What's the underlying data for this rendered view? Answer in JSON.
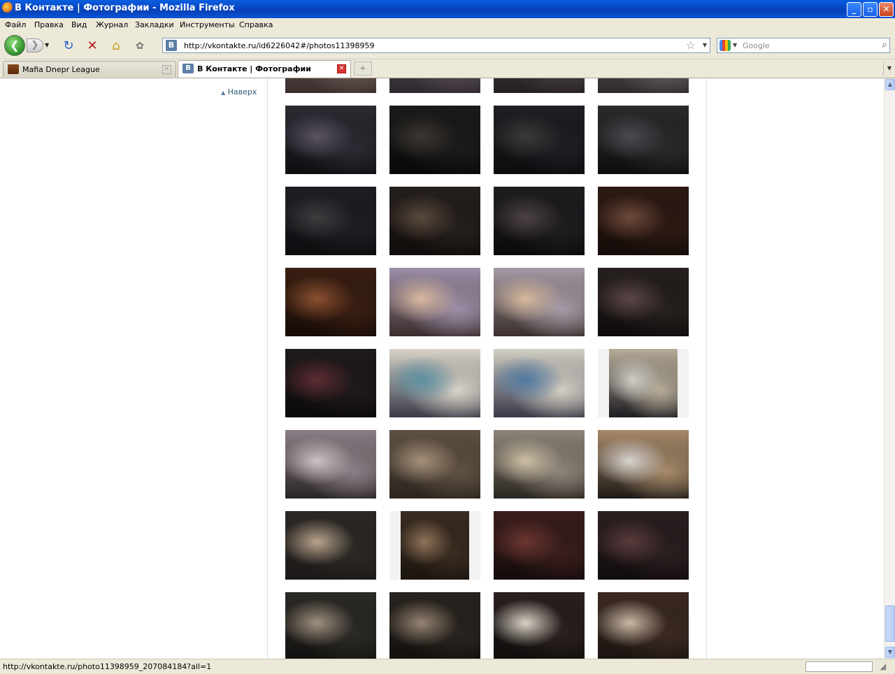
{
  "window": {
    "title": "В Контакте | Фотографии - Mozilla Firefox",
    "buttons": {
      "minimize": "_",
      "maximize": "▫",
      "close": "✕"
    }
  },
  "menu": [
    "Файл",
    "Правка",
    "Вид",
    "Журнал",
    "Закладки",
    "Инструменты",
    "Справка"
  ],
  "navigation": {
    "back_glyph": "❮",
    "forward_glyph": "❯",
    "url": "http://vkontakte.ru/id6226042#/photos11398959",
    "site_icon_letter": "B",
    "search_placeholder": "Google"
  },
  "tabs": [
    {
      "label": "Mafia Dnepr League",
      "active": false
    },
    {
      "label": "В Контакте | Фотографии",
      "active": true
    }
  ],
  "page": {
    "top_link": "Наверх",
    "photo_rows": [
      [
        {
          "colors": [
            "#6d5b57",
            "#c9b8aa",
            "#3a2e2d"
          ]
        },
        {
          "colors": [
            "#5a4d55",
            "#b9aba7",
            "#2f2a30"
          ]
        },
        {
          "colors": [
            "#4a4141",
            "#a8988f",
            "#252020"
          ]
        },
        {
          "colors": [
            "#6b6060",
            "#b7a89c",
            "#2f2b2b"
          ]
        }
      ],
      [
        {
          "colors": [
            "#2b2b33",
            "#5b5462",
            "#0f0f12"
          ]
        },
        {
          "colors": [
            "#1b1b1b",
            "#3d3731",
            "#090909"
          ]
        },
        {
          "colors": [
            "#1e1f24",
            "#3c3b3a",
            "#0c0c0e"
          ]
        },
        {
          "colors": [
            "#2c2a2a",
            "#4d4b53",
            "#0e0d0d"
          ]
        }
      ],
      [
        {
          "colors": [
            "#1d1f22",
            "#3b3d3f",
            "#0c0d0f"
          ]
        },
        {
          "colors": [
            "#26201d",
            "#5a4a3d",
            "#100c0b"
          ]
        },
        {
          "colors": [
            "#1f1d20",
            "#4d4346",
            "#0b0a0c"
          ]
        },
        {
          "colors": [
            "#2d1a14",
            "#6e4a3b",
            "#140b08"
          ]
        }
      ],
      [
        {
          "colors": [
            "#3a1f12",
            "#8a5030",
            "#160b07"
          ]
        },
        {
          "colors": [
            "#9c8fa7",
            "#d8b79e",
            "#3a2d2d"
          ]
        },
        {
          "colors": [
            "#a59aa6",
            "#d6b89c",
            "#3a2f2c"
          ]
        },
        {
          "colors": [
            "#27211f",
            "#5c4646",
            "#0e0b0b"
          ]
        }
      ],
      [
        {
          "colors": [
            "#1f1a1b",
            "#5d2d34",
            "#0b0909"
          ]
        },
        {
          "colors": [
            "#d9d3c8",
            "#5a8fa0",
            "#3a3a48"
          ]
        },
        {
          "colors": [
            "#d2cfc4",
            "#4f78a0",
            "#3b3848"
          ]
        },
        {
          "colors": [
            "#b7ac98",
            "#cfcdc8",
            "#1e1d22"
          ],
          "narrow": true
        }
      ],
      [
        {
          "colors": [
            "#8a7f86",
            "#cdc2c6",
            "#2a2426"
          ]
        },
        {
          "colors": [
            "#5f5142",
            "#a6927c",
            "#2b241e"
          ]
        },
        {
          "colors": [
            "#8d857a",
            "#cdbfa4",
            "#2c2622"
          ]
        },
        {
          "colors": [
            "#a78a6a",
            "#d7d3cf",
            "#1e1a17"
          ]
        }
      ],
      [
        {
          "colors": [
            "#2b2825",
            "#b9a38c",
            "#1c1918"
          ]
        },
        {
          "colors": [
            "#3a2c20",
            "#8f7259",
            "#1b1510"
          ],
          "narrow": true
        },
        {
          "colors": [
            "#3a1e1d",
            "#6c3630",
            "#140b0b"
          ]
        },
        {
          "colors": [
            "#2c2021",
            "#5a3b3d",
            "#100b0c"
          ]
        }
      ],
      [
        {
          "colors": [
            "#2c2a27",
            "#a0907f",
            "#141210"
          ]
        },
        {
          "colors": [
            "#29241f",
            "#968472",
            "#12100e"
          ]
        },
        {
          "colors": [
            "#2a2120",
            "#d8d2c6",
            "#0f0c0b"
          ]
        },
        {
          "colors": [
            "#3b2a22",
            "#c9b8a4",
            "#1a1310"
          ]
        }
      ]
    ]
  },
  "status": {
    "text": "http://vkontakte.ru/photo11398959_207084184?all=1"
  },
  "colors": {
    "titlebar": "#0846c4",
    "chrome": "#ece9d8",
    "link": "#2b587a",
    "divider": "#dae1e8"
  }
}
